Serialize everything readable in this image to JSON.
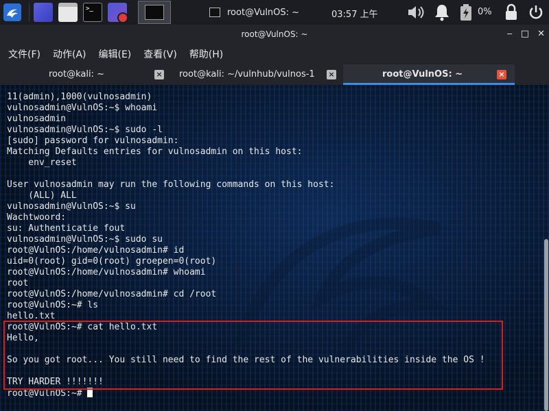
{
  "panel": {
    "launcher_icon": "kali-dragon-icon",
    "quick_launch": [
      {
        "name": "show-desktop-icon"
      },
      {
        "name": "file-manager-icon"
      },
      {
        "name": "terminal-icon"
      },
      {
        "name": "screen-recorder-icon"
      }
    ],
    "task": {
      "label": "root@VulnOS: ~"
    },
    "clock": "03:57 上午",
    "battery": "0%"
  },
  "window": {
    "title": "root@VulnOS: ~",
    "controls": {
      "minimize": "‒",
      "maximize": "□",
      "close": "✕"
    }
  },
  "menu": [
    "文件(F)",
    "动作(A)",
    "编辑(E)",
    "查看(V)",
    "帮助(H)"
  ],
  "tabs": [
    {
      "label": "root@kali: ~",
      "active": false
    },
    {
      "label": "root@kali: ~/vulnhub/vulnos-1",
      "active": false
    },
    {
      "label": "root@VulnOS: ~",
      "active": true
    }
  ],
  "terminal": {
    "lines": [
      "11(admin),1000(vulnosadmin)",
      "vulnosadmin@VulnOS:~$ whoami",
      "vulnosadmin",
      "vulnosadmin@VulnOS:~$ sudo -l",
      "[sudo] password for vulnosadmin:",
      "Matching Defaults entries for vulnosadmin on this host:",
      "    env_reset",
      "",
      "User vulnosadmin may run the following commands on this host:",
      "    (ALL) ALL",
      "vulnosadmin@VulnOS:~$ su",
      "Wachtwoord:",
      "su: Authenticatie fout",
      "vulnosadmin@VulnOS:~$ sudo su",
      "root@VulnOS:/home/vulnosadmin# id",
      "uid=0(root) gid=0(root) groepen=0(root)",
      "root@VulnOS:/home/vulnosadmin# whoami",
      "root",
      "root@VulnOS:/home/vulnosadmin# cd /root",
      "root@VulnOS:~# ls",
      "hello.txt",
      "root@VulnOS:~# cat hello.txt",
      "Hello,",
      "",
      "So you got root... You still need to find the rest of the vulnerabilities inside the OS !",
      "",
      "TRY HARDER !!!!!!!"
    ],
    "prompt": "root@VulnOS:~# "
  }
}
